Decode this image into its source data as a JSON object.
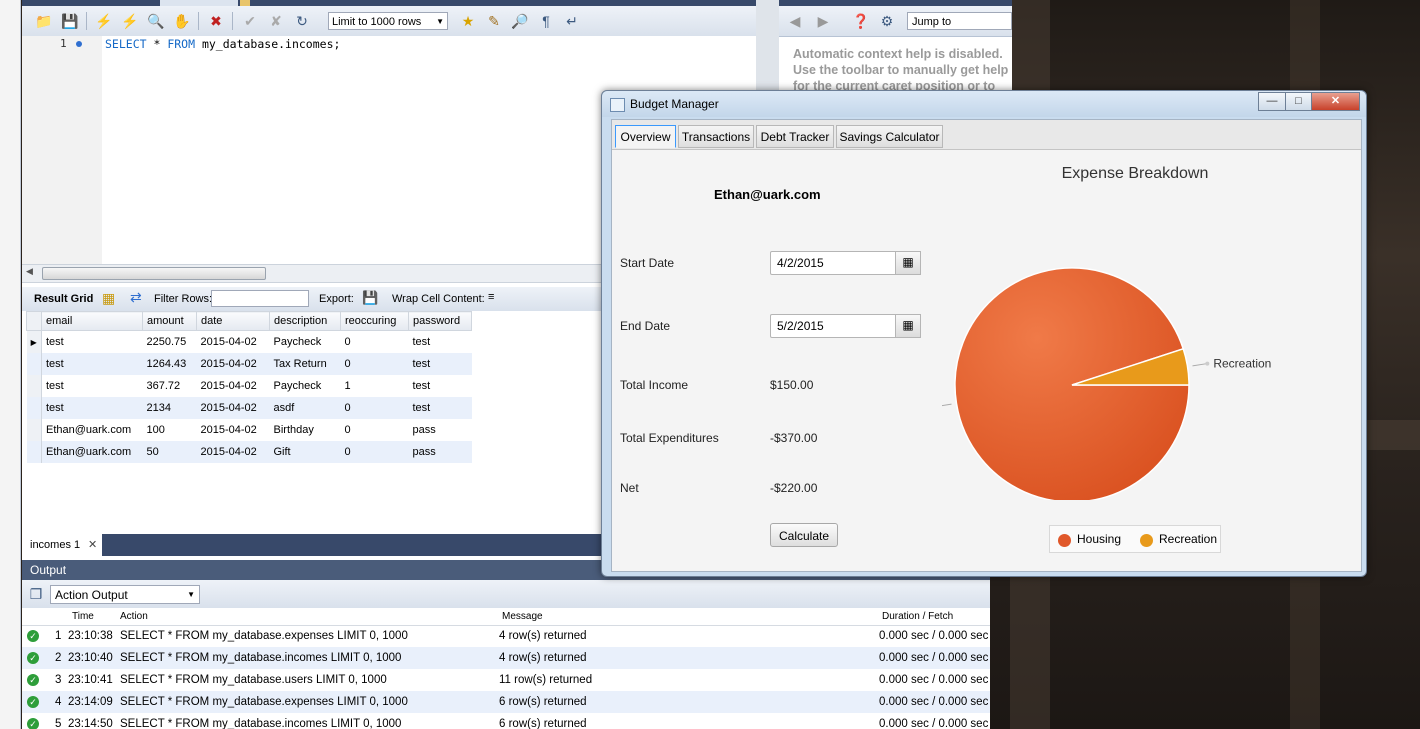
{
  "workbench": {
    "toolbar": {
      "limit_select": "Limit to 1000 rows"
    },
    "editor": {
      "line_number": "1",
      "sql_kw1": "SELECT",
      "sql_mid": " * ",
      "sql_kw2": "FROM",
      "sql_rest": " my_database.incomes;"
    },
    "result_toolbar": {
      "result_grid": "Result Grid",
      "filter_rows": "Filter Rows:",
      "export": "Export:",
      "wrap": "Wrap Cell Content:"
    },
    "grid": {
      "columns": [
        "email",
        "amount",
        "date",
        "description",
        "reoccuring",
        "password"
      ],
      "rows": [
        [
          "test",
          "2250.75",
          "2015-04-02",
          "Paycheck",
          "0",
          "test"
        ],
        [
          "test",
          "1264.43",
          "2015-04-02",
          "Tax Return",
          "0",
          "test"
        ],
        [
          "test",
          "367.72",
          "2015-04-02",
          "Paycheck",
          "1",
          "test"
        ],
        [
          "test",
          "2134",
          "2015-04-02",
          "asdf",
          "0",
          "test"
        ],
        [
          "Ethan@uark.com",
          "100",
          "2015-04-02",
          "Birthday",
          "0",
          "pass"
        ],
        [
          "Ethan@uark.com",
          "50",
          "2015-04-02",
          "Gift",
          "0",
          "pass"
        ]
      ]
    },
    "result_tab": "incomes 1",
    "help": {
      "jump_to": "Jump to",
      "text": "Automatic context help is disabled. Use the toolbar to manually get help for the current caret position or to toggle automatic help."
    },
    "output": {
      "header": "Output",
      "action_select": "Action Output",
      "columns": [
        "Time",
        "Action",
        "Message",
        "Duration / Fetch"
      ],
      "rows": [
        [
          "1",
          "23:10:38",
          "SELECT * FROM my_database.expenses LIMIT 0, 1000",
          "4 row(s) returned",
          "0.000 sec / 0.000 sec"
        ],
        [
          "2",
          "23:10:40",
          "SELECT * FROM my_database.incomes LIMIT 0, 1000",
          "4 row(s) returned",
          "0.000 sec / 0.000 sec"
        ],
        [
          "3",
          "23:10:41",
          "SELECT * FROM my_database.users LIMIT 0, 1000",
          "11 row(s) returned",
          "0.000 sec / 0.000 sec"
        ],
        [
          "4",
          "23:14:09",
          "SELECT * FROM my_database.expenses LIMIT 0, 1000",
          "6 row(s) returned",
          "0.000 sec / 0.000 sec"
        ],
        [
          "5",
          "23:14:50",
          "SELECT * FROM my_database.incomes LIMIT 0, 1000",
          "6 row(s) returned",
          "0.000 sec / 0.000 sec"
        ]
      ]
    }
  },
  "budget": {
    "title": "Budget Manager",
    "tabs": [
      "Overview",
      "Transactions",
      "Debt Tracker",
      "Savings Calculator"
    ],
    "user": "Ethan@uark.com",
    "start_label": "Start Date",
    "start_value": "4/2/2015",
    "end_label": "End Date",
    "end_value": "5/2/2015",
    "income_label": "Total Income",
    "income_value": "$150.00",
    "exp_label": "Total Expenditures",
    "exp_value": "-$370.00",
    "net_label": "Net",
    "net_value": "-$220.00",
    "calculate": "Calculate",
    "colors": {
      "housing": "#e0582a",
      "recreation": "#e89a1b",
      "accent": "#3b99fc"
    }
  },
  "chart_data": {
    "type": "pie",
    "title": "Expense Breakdown",
    "categories": [
      "Housing",
      "Recreation"
    ],
    "values": [
      95,
      5
    ],
    "legend": "bottom"
  }
}
